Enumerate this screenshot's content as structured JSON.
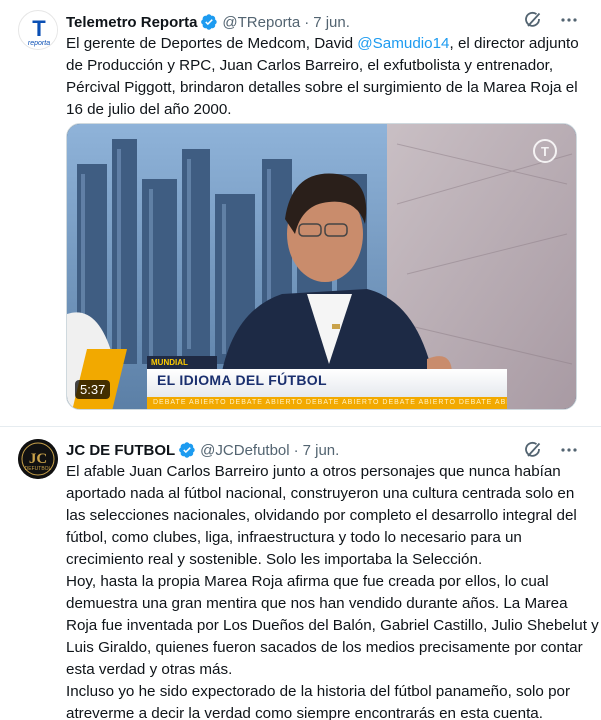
{
  "tweets": [
    {
      "author_name": "Telemetro Reporta",
      "handle": "@TReporta",
      "separator": "·",
      "date": "7 jun.",
      "avatar_text": "reporta",
      "avatar_letter": "T",
      "text_lines": [
        [
          "El gerente de Deportes de Medcom, David ",
          "@Samudio14",
          ", el director adjunto"
        ],
        [
          "de Producción y RPC, Juan Carlos Barreiro, el exfutbolista y entrenador,"
        ],
        [
          "Pércival Piggott, brindaron detalles sobre el surgimiento de la Marea Roja el"
        ],
        [
          "16 de julio del año 2000."
        ]
      ],
      "video": {
        "duration": "5:37",
        "tag": "MUNDIAL",
        "title": "EL IDIOMA DEL FÚTBOL",
        "ticker": "DEBATE ABIERTO   DEBATE ABIERTO   DEBATE ABIERTO   DEBATE ABIERTO   DEBATE ABIERTO"
      }
    },
    {
      "author_name": "JC DE FUTBOL",
      "handle": "@JCDefutbol",
      "separator": "·",
      "date": "7 jun.",
      "avatar_text": "DEFUTBOL",
      "avatar_letter": "JC",
      "text_lines": [
        "El afable Juan Carlos Barreiro junto a otros personajes que nunca habían",
        "aportado nada al fútbol nacional, construyeron una cultura centrada solo en",
        "las selecciones nacionales, olvidando por completo el desarrollo integral del",
        "fútbol, como clubes, liga, infraestructura y todo lo necesario para un",
        "crecimiento real y sostenible. Solo les importaba la Selección.",
        "Hoy, hasta la propia Marea Roja afirma que fue creada por ellos, lo cual",
        "demuestra una gran mentira que nos han vendido durante años. La Marea",
        "Roja fue inventada por Los Dueños del Balón, Gabriel Castillo, Julio Shebelut y",
        "Luis Giraldo, quienes fueron sacados de los medios precisamente por contar",
        "esta verdad y otras más.",
        "Incluso yo he sido expectorado de la historia del fútbol panameño, solo por",
        "atreverme a decir la verdad como  siempre encontrarás en esta cuenta."
      ]
    }
  ],
  "colors": {
    "accent": "#1d9bf0",
    "text": "#0f1419",
    "secondary": "#536471"
  },
  "icons": [
    "verified-badge-icon",
    "grok-icon",
    "more-icon"
  ]
}
